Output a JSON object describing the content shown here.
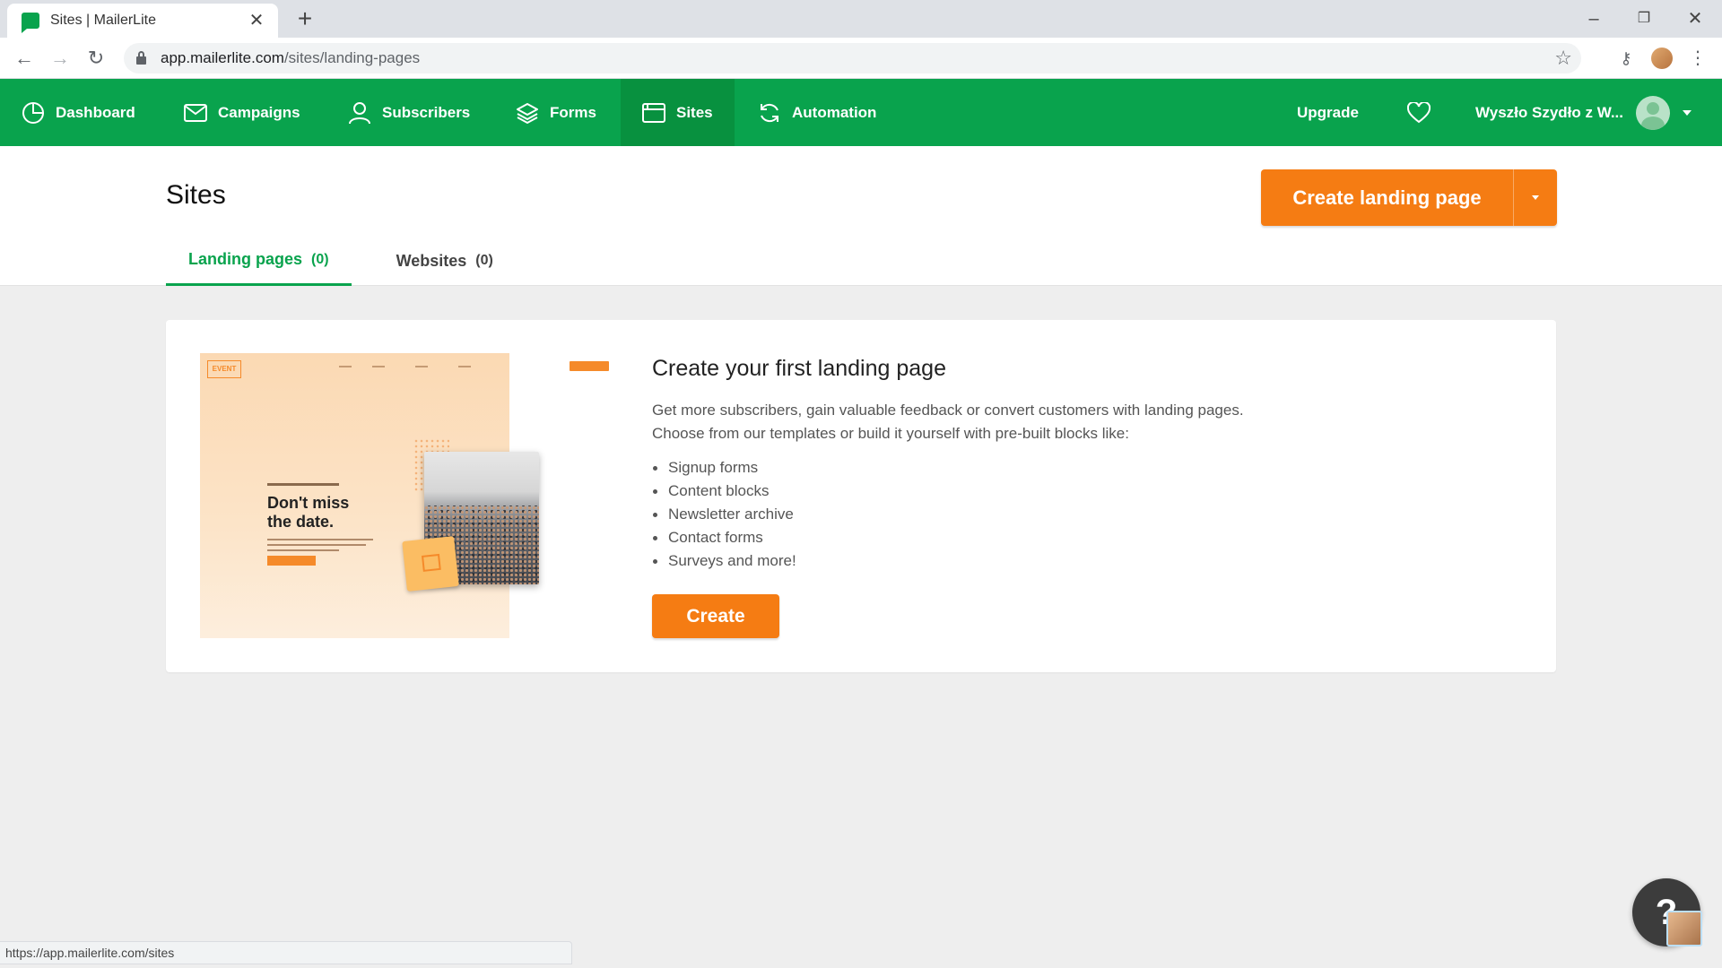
{
  "browser": {
    "tab_title": "Sites | MailerLite",
    "url_host": "app.mailerlite.com",
    "url_path": "/sites/landing-pages",
    "status_url": "https://app.mailerlite.com/sites"
  },
  "nav": {
    "items": [
      {
        "label": "Dashboard",
        "icon": "dashboard-icon"
      },
      {
        "label": "Campaigns",
        "icon": "mail-icon"
      },
      {
        "label": "Subscribers",
        "icon": "user-icon"
      },
      {
        "label": "Forms",
        "icon": "layers-icon"
      },
      {
        "label": "Sites",
        "icon": "browser-window-icon",
        "active": true
      },
      {
        "label": "Automation",
        "icon": "refresh-icon"
      }
    ],
    "upgrade": "Upgrade",
    "account": "Wyszło Szydło z W..."
  },
  "page": {
    "title": "Sites",
    "create_button": "Create landing page",
    "tabs": [
      {
        "label": "Landing pages",
        "count": "(0)",
        "active": true
      },
      {
        "label": "Websites",
        "count": "(0)"
      }
    ]
  },
  "card": {
    "title": "Create your first landing page",
    "desc_line1": "Get more subscribers, gain valuable feedback or convert customers with landing pages.",
    "desc_line2": "Choose from our templates or build it yourself with pre-built blocks like:",
    "features": [
      "Signup forms",
      "Content blocks",
      "Newsletter archive",
      "Contact forms",
      "Surveys and more!"
    ],
    "create_button": "Create",
    "illustration": {
      "logo": "EVENT",
      "headline_line1": "Don't miss",
      "headline_line2": "the date."
    }
  },
  "help": {
    "icon": "?"
  },
  "colors": {
    "brand_green": "#09a34d",
    "accent_orange": "#f57c13"
  }
}
